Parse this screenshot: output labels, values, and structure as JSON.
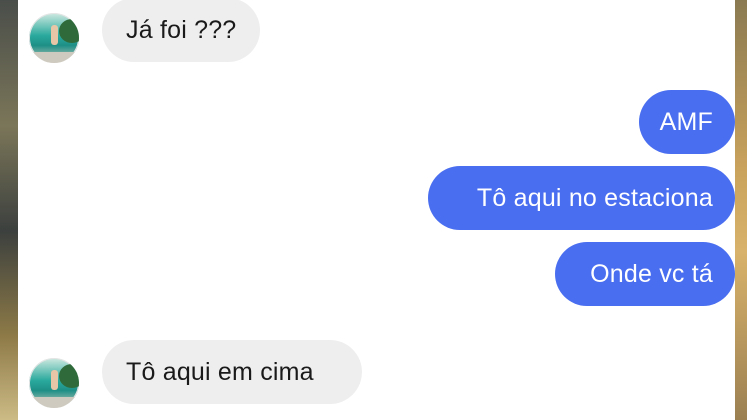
{
  "conversation": {
    "messages": [
      {
        "direction": "incoming",
        "text": "Já foi ???"
      },
      {
        "direction": "outgoing",
        "text": "AMF"
      },
      {
        "direction": "outgoing",
        "text": "Tô aqui no estaciona"
      },
      {
        "direction": "outgoing",
        "text": "Onde vc tá"
      },
      {
        "direction": "incoming",
        "text": "Tô aqui em cima"
      }
    ]
  },
  "colors": {
    "outgoing_bubble": "#4a6ef0",
    "incoming_bubble": "#eeeeef",
    "background": "#ffffff"
  },
  "icons": {
    "contact_avatar": "profile-photo-avatar"
  }
}
